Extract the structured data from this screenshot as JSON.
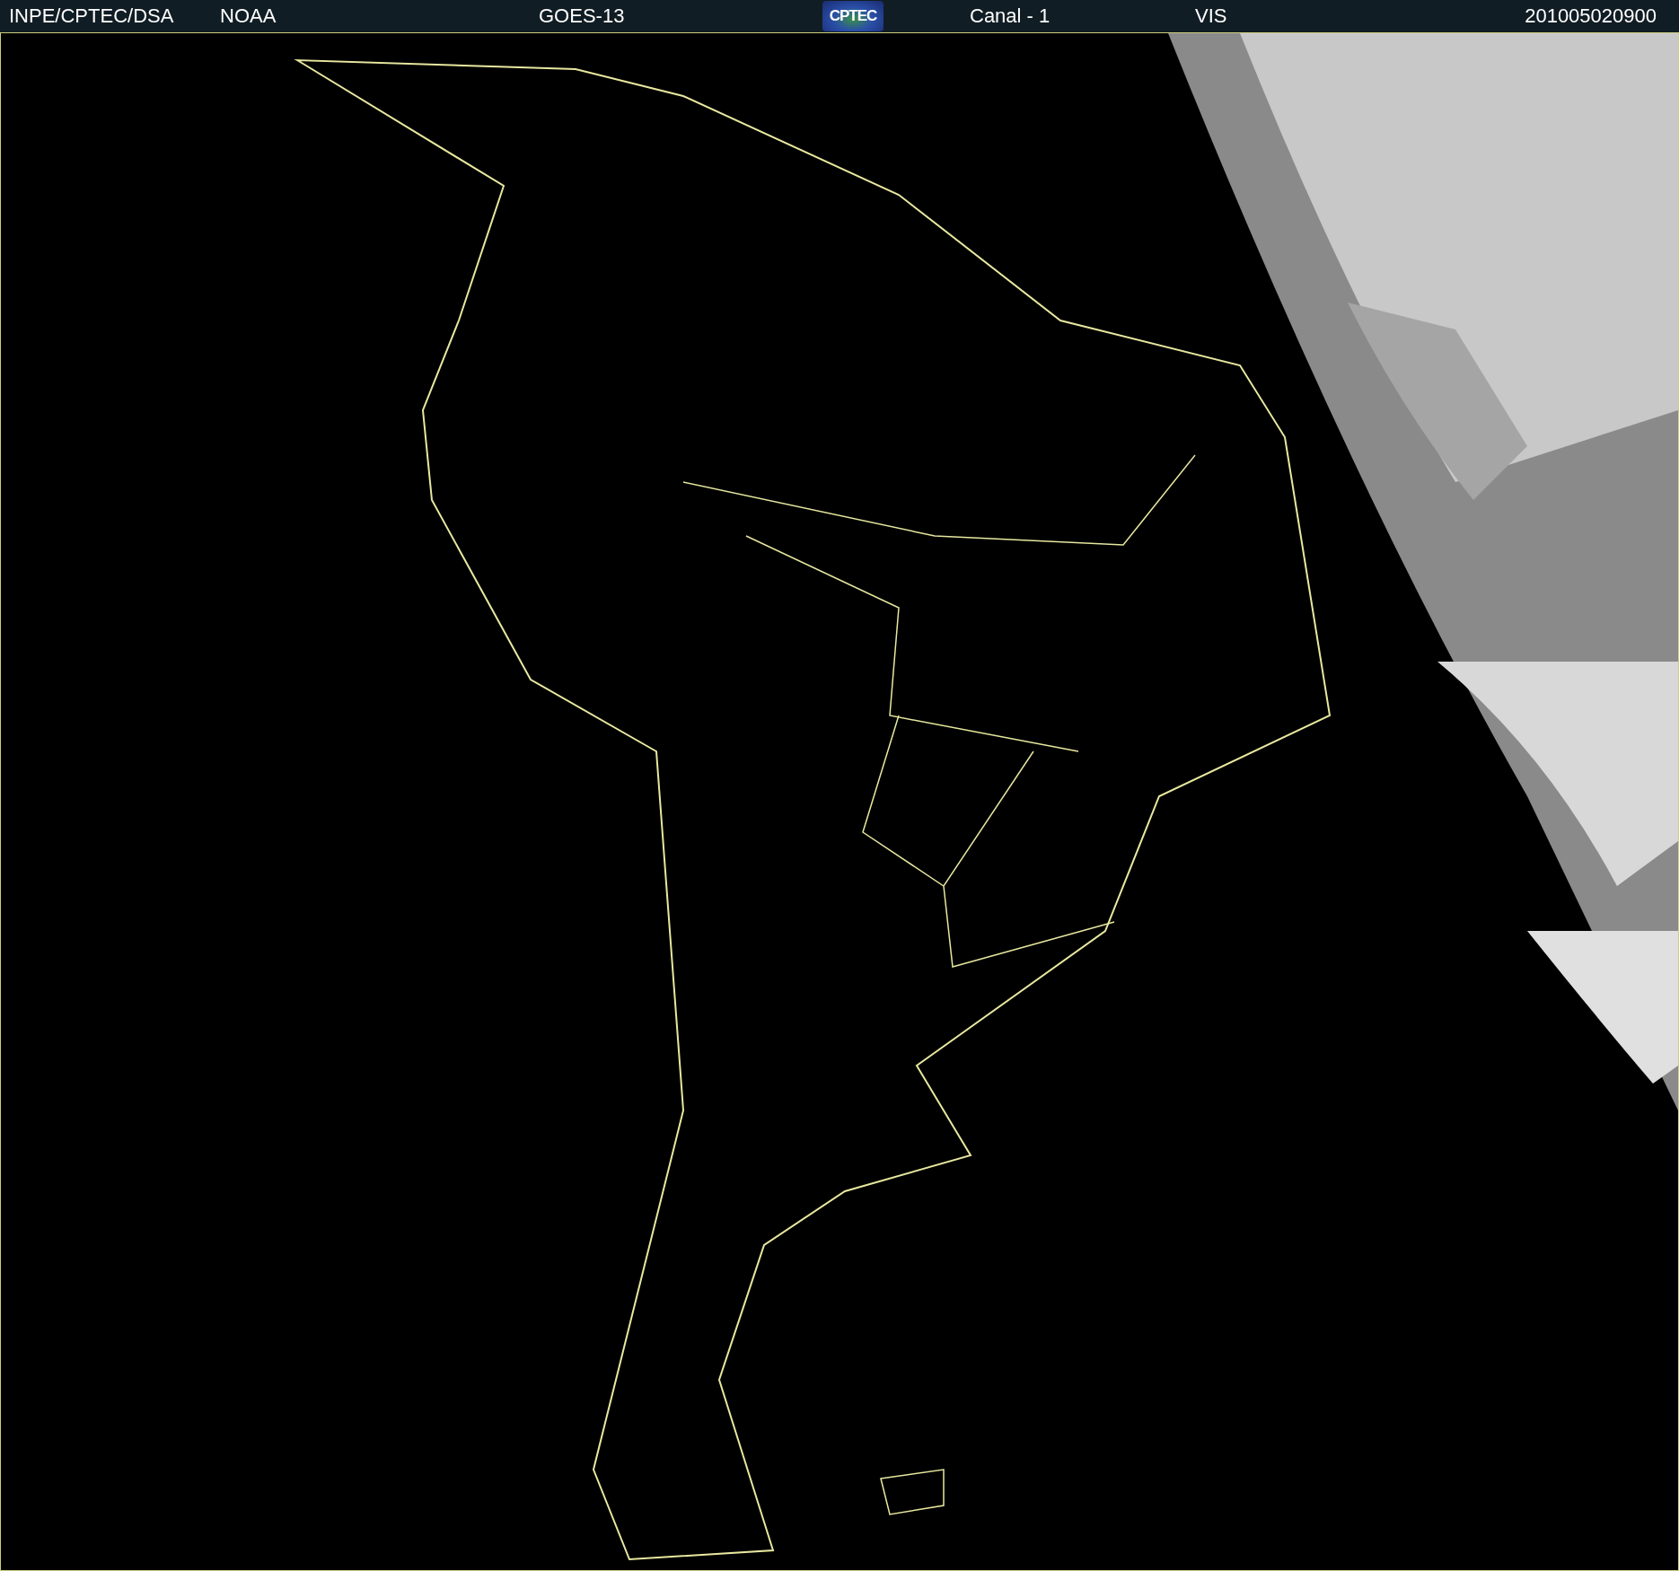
{
  "header": {
    "source": "INPE/CPTEC/DSA",
    "agency": "NOAA",
    "satellite": "GOES-13",
    "logo_text": "CPTEC",
    "channel": "Canal - 1",
    "band": "VIS",
    "timestamp": "201005020900"
  }
}
